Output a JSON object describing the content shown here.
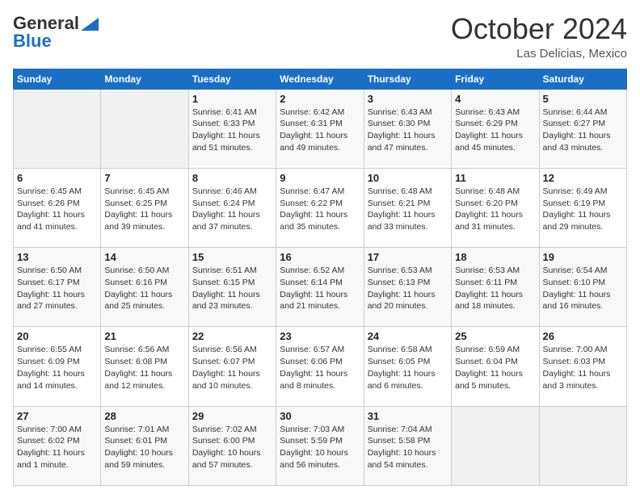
{
  "header": {
    "logo_general": "General",
    "logo_blue": "Blue",
    "month_title": "October 2024",
    "location": "Las Delicias, Mexico"
  },
  "calendar": {
    "headers": [
      "Sunday",
      "Monday",
      "Tuesday",
      "Wednesday",
      "Thursday",
      "Friday",
      "Saturday"
    ],
    "rows": [
      [
        {
          "day": "",
          "info": ""
        },
        {
          "day": "",
          "info": ""
        },
        {
          "day": "1",
          "info": "Sunrise: 6:41 AM\nSunset: 6:33 PM\nDaylight: 11 hours\nand 51 minutes."
        },
        {
          "day": "2",
          "info": "Sunrise: 6:42 AM\nSunset: 6:31 PM\nDaylight: 11 hours\nand 49 minutes."
        },
        {
          "day": "3",
          "info": "Sunrise: 6:43 AM\nSunset: 6:30 PM\nDaylight: 11 hours\nand 47 minutes."
        },
        {
          "day": "4",
          "info": "Sunrise: 6:43 AM\nSunset: 6:29 PM\nDaylight: 11 hours\nand 45 minutes."
        },
        {
          "day": "5",
          "info": "Sunrise: 6:44 AM\nSunset: 6:27 PM\nDaylight: 11 hours\nand 43 minutes."
        }
      ],
      [
        {
          "day": "6",
          "info": "Sunrise: 6:45 AM\nSunset: 6:26 PM\nDaylight: 11 hours\nand 41 minutes."
        },
        {
          "day": "7",
          "info": "Sunrise: 6:45 AM\nSunset: 6:25 PM\nDaylight: 11 hours\nand 39 minutes."
        },
        {
          "day": "8",
          "info": "Sunrise: 6:46 AM\nSunset: 6:24 PM\nDaylight: 11 hours\nand 37 minutes."
        },
        {
          "day": "9",
          "info": "Sunrise: 6:47 AM\nSunset: 6:22 PM\nDaylight: 11 hours\nand 35 minutes."
        },
        {
          "day": "10",
          "info": "Sunrise: 6:48 AM\nSunset: 6:21 PM\nDaylight: 11 hours\nand 33 minutes."
        },
        {
          "day": "11",
          "info": "Sunrise: 6:48 AM\nSunset: 6:20 PM\nDaylight: 11 hours\nand 31 minutes."
        },
        {
          "day": "12",
          "info": "Sunrise: 6:49 AM\nSunset: 6:19 PM\nDaylight: 11 hours\nand 29 minutes."
        }
      ],
      [
        {
          "day": "13",
          "info": "Sunrise: 6:50 AM\nSunset: 6:17 PM\nDaylight: 11 hours\nand 27 minutes."
        },
        {
          "day": "14",
          "info": "Sunrise: 6:50 AM\nSunset: 6:16 PM\nDaylight: 11 hours\nand 25 minutes."
        },
        {
          "day": "15",
          "info": "Sunrise: 6:51 AM\nSunset: 6:15 PM\nDaylight: 11 hours\nand 23 minutes."
        },
        {
          "day": "16",
          "info": "Sunrise: 6:52 AM\nSunset: 6:14 PM\nDaylight: 11 hours\nand 21 minutes."
        },
        {
          "day": "17",
          "info": "Sunrise: 6:53 AM\nSunset: 6:13 PM\nDaylight: 11 hours\nand 20 minutes."
        },
        {
          "day": "18",
          "info": "Sunrise: 6:53 AM\nSunset: 6:11 PM\nDaylight: 11 hours\nand 18 minutes."
        },
        {
          "day": "19",
          "info": "Sunrise: 6:54 AM\nSunset: 6:10 PM\nDaylight: 11 hours\nand 16 minutes."
        }
      ],
      [
        {
          "day": "20",
          "info": "Sunrise: 6:55 AM\nSunset: 6:09 PM\nDaylight: 11 hours\nand 14 minutes."
        },
        {
          "day": "21",
          "info": "Sunrise: 6:56 AM\nSunset: 6:08 PM\nDaylight: 11 hours\nand 12 minutes."
        },
        {
          "day": "22",
          "info": "Sunrise: 6:56 AM\nSunset: 6:07 PM\nDaylight: 11 hours\nand 10 minutes."
        },
        {
          "day": "23",
          "info": "Sunrise: 6:57 AM\nSunset: 6:06 PM\nDaylight: 11 hours\nand 8 minutes."
        },
        {
          "day": "24",
          "info": "Sunrise: 6:58 AM\nSunset: 6:05 PM\nDaylight: 11 hours\nand 6 minutes."
        },
        {
          "day": "25",
          "info": "Sunrise: 6:59 AM\nSunset: 6:04 PM\nDaylight: 11 hours\nand 5 minutes."
        },
        {
          "day": "26",
          "info": "Sunrise: 7:00 AM\nSunset: 6:03 PM\nDaylight: 11 hours\nand 3 minutes."
        }
      ],
      [
        {
          "day": "27",
          "info": "Sunrise: 7:00 AM\nSunset: 6:02 PM\nDaylight: 11 hours\nand 1 minute."
        },
        {
          "day": "28",
          "info": "Sunrise: 7:01 AM\nSunset: 6:01 PM\nDaylight: 10 hours\nand 59 minutes."
        },
        {
          "day": "29",
          "info": "Sunrise: 7:02 AM\nSunset: 6:00 PM\nDaylight: 10 hours\nand 57 minutes."
        },
        {
          "day": "30",
          "info": "Sunrise: 7:03 AM\nSunset: 5:59 PM\nDaylight: 10 hours\nand 56 minutes."
        },
        {
          "day": "31",
          "info": "Sunrise: 7:04 AM\nSunset: 5:58 PM\nDaylight: 10 hours\nand 54 minutes."
        },
        {
          "day": "",
          "info": ""
        },
        {
          "day": "",
          "info": ""
        }
      ]
    ]
  }
}
